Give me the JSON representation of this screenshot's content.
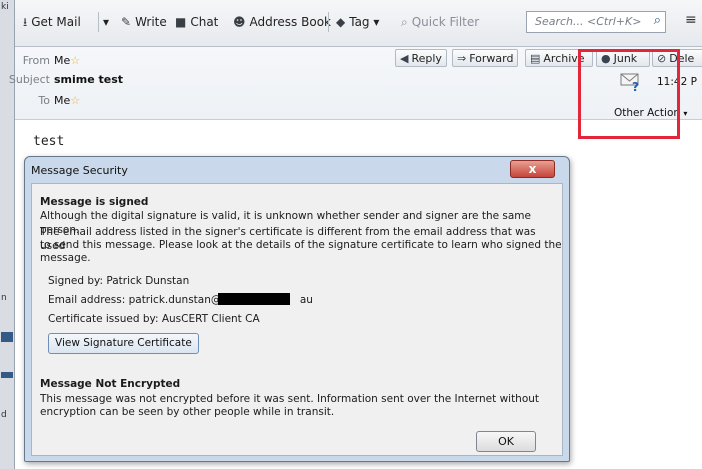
{
  "left_strip": {
    "labels": [
      "ki",
      "n",
      "d"
    ]
  },
  "toolbar": {
    "get_mail": "Get Mail",
    "write": "Write",
    "chat": "Chat",
    "address_book": "Address Book",
    "tag": "Tag",
    "quick_filter": "Quick Filter",
    "search_placeholder": "Search... <Ctrl+K>"
  },
  "header": {
    "from_label": "From",
    "from_value": "Me",
    "subject_label": "Subject",
    "subject_value": "smime test",
    "to_label": "To",
    "to_value": "Me",
    "time": "11:42 P",
    "other_actions": "Other Action",
    "buttons": {
      "reply": "Reply",
      "forward": "Forward",
      "archive": "Archive",
      "junk": "Junk",
      "delete": "Dele"
    }
  },
  "message": {
    "body": "test"
  },
  "dialog": {
    "title": "Message Security",
    "close": "x",
    "signed_heading": "Message is signed",
    "signed_line1": "Although the digital signature is valid, it is unknown whether sender and signer are the same person.",
    "signed_line2": "The email address listed in the signer's certificate is different from the email address that was used",
    "signed_line3": "to send this message. Please look at the details of the signature certificate to learn who signed the",
    "signed_line4": "message.",
    "signed_by": "Signed by:   Patrick Dunstan",
    "email_prefix": "Email address:   patrick.dunstan@a",
    "email_suffix": "au",
    "cert_issued": "Certificate issued by:   AusCERT Client CA",
    "view_cert_button": "View Signature Certificate",
    "enc_heading": "Message Not Encrypted",
    "enc_line1": "This message was not encrypted before it was sent. Information sent over the Internet without",
    "enc_line2": "encryption can be seen by other people while in transit.",
    "ok_button": "OK"
  },
  "colors": {
    "highlight_box": "#e3263a",
    "dialog_frame": "#c9d8ea"
  }
}
